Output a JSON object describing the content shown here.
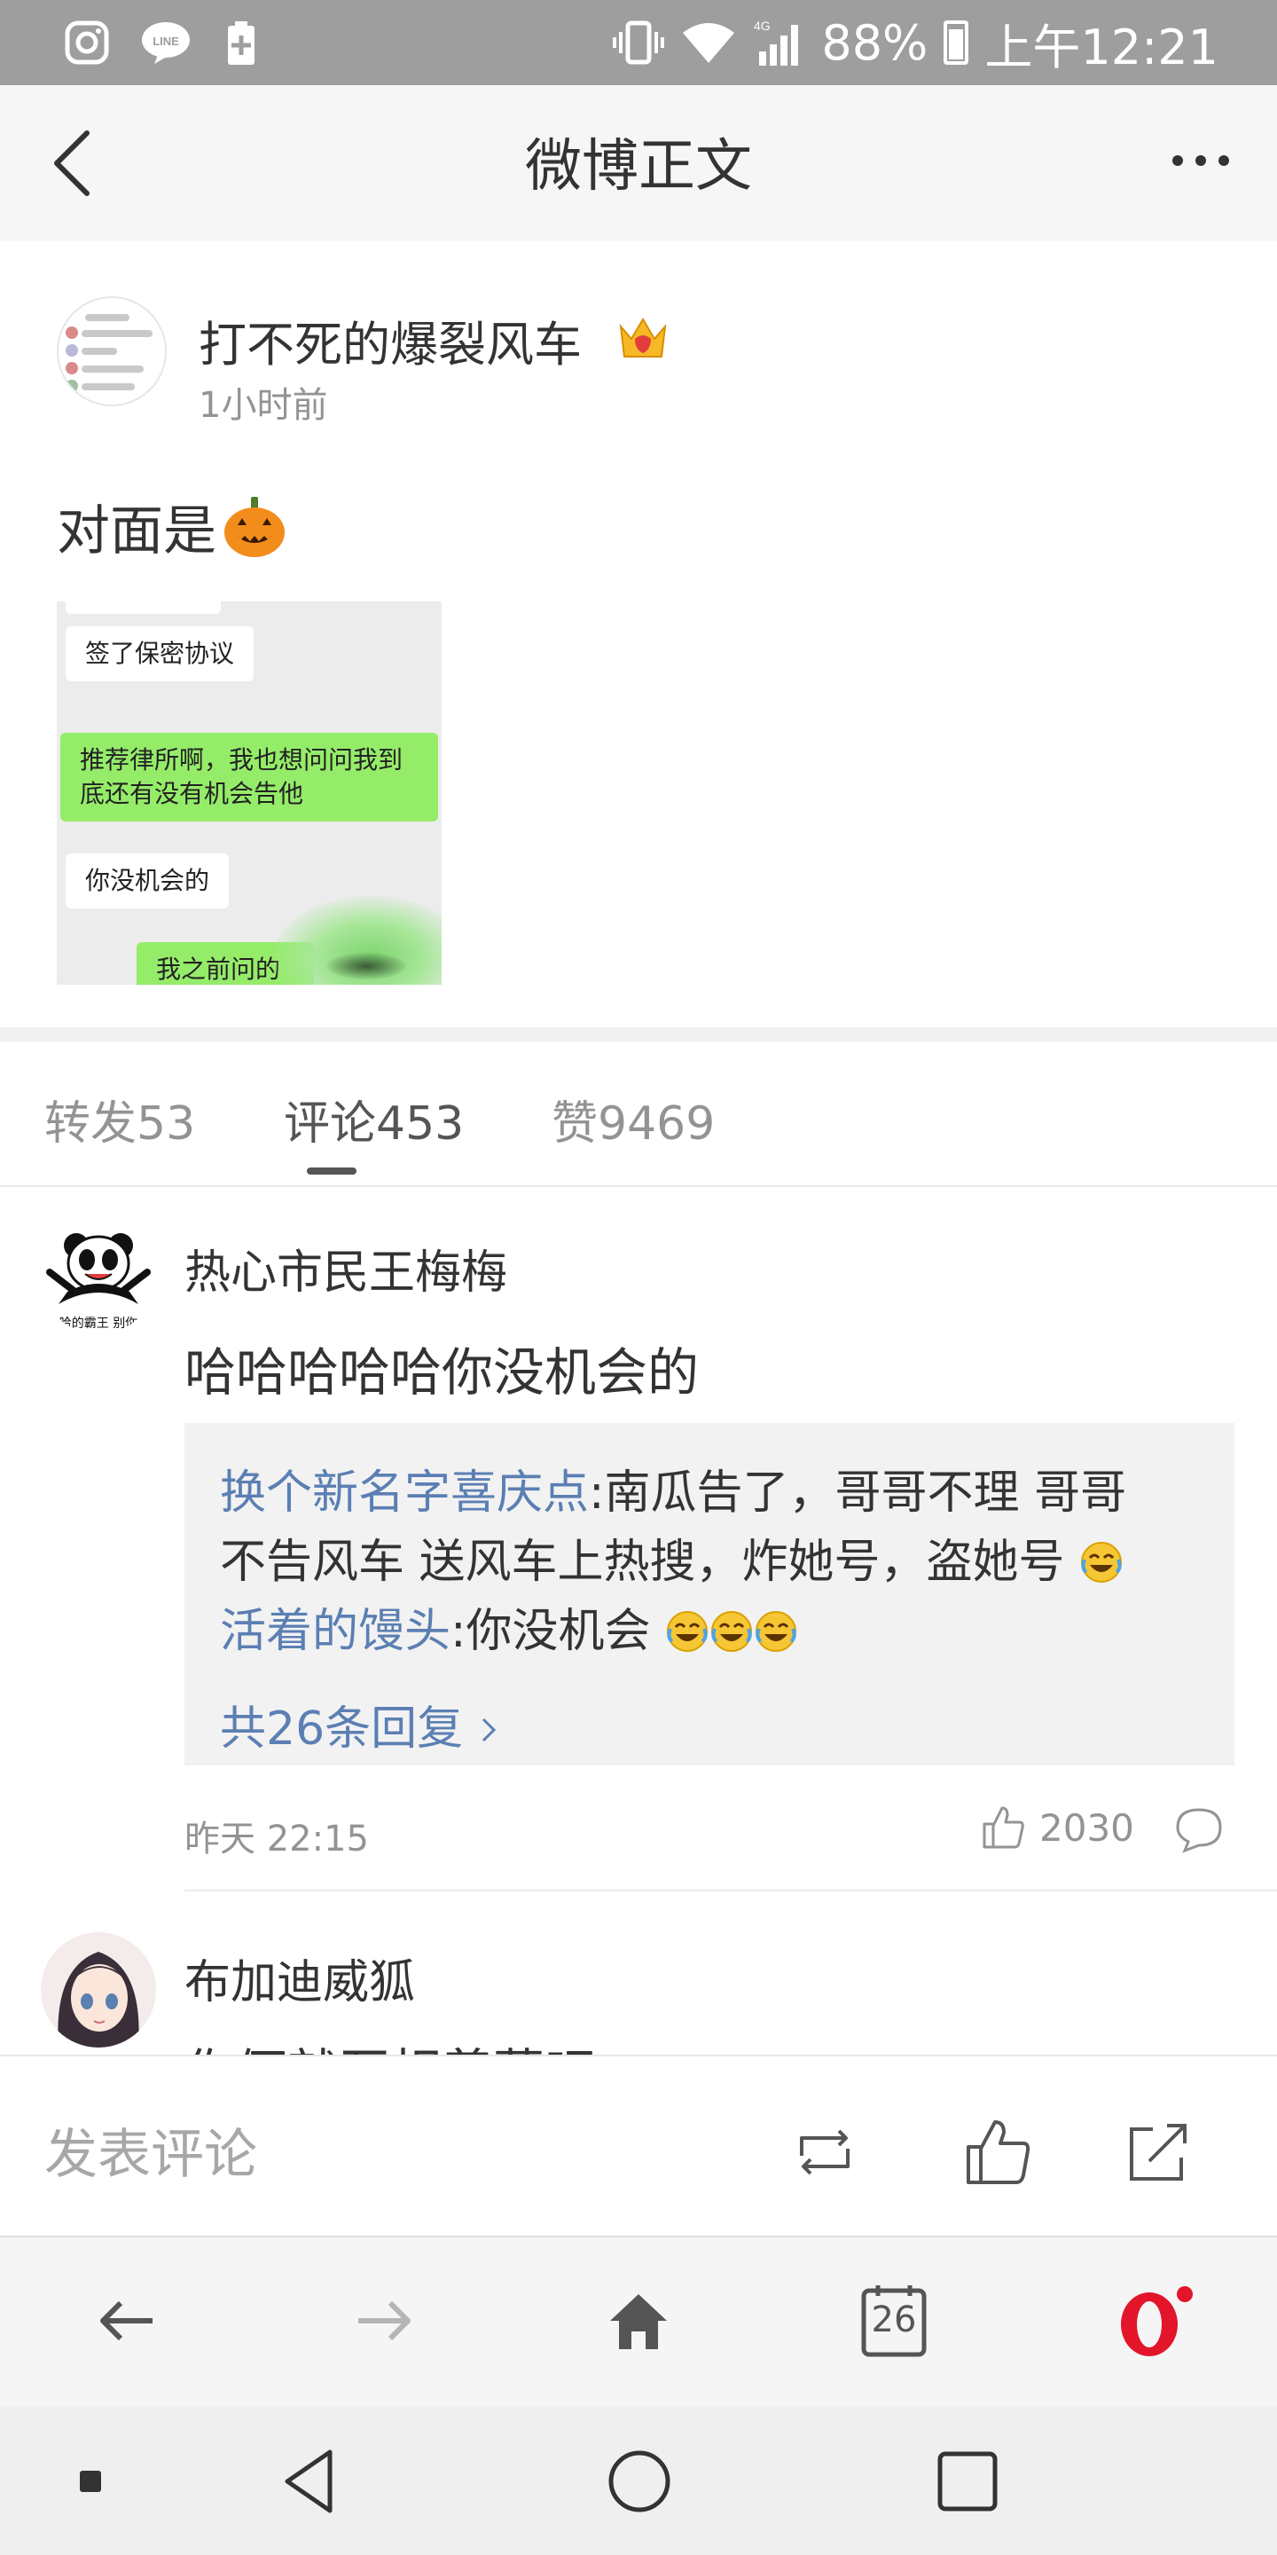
{
  "status_bar": {
    "battery": "88%",
    "time": "上午12:21",
    "network": "4G",
    "icons": [
      "instagram-icon",
      "line-icon",
      "battery-saver-icon",
      "vibrate-icon",
      "wifi-icon",
      "signal-icon",
      "battery-icon"
    ]
  },
  "nav": {
    "title": "微博正文"
  },
  "post": {
    "username": "打不死的爆裂风车",
    "time": "1小时前",
    "text": "对面是",
    "image_chat": {
      "bubbles": [
        {
          "text": "签了保密协议",
          "side": "left"
        },
        {
          "text": "推荐律所啊，我也想问问我到底还有没有机会告他",
          "side": "right"
        },
        {
          "text": "你没机会的",
          "side": "left"
        },
        {
          "text": "我之前问的",
          "side": "right"
        }
      ]
    }
  },
  "tabs": [
    {
      "label": "转发53",
      "active": false
    },
    {
      "label": "评论453",
      "active": true
    },
    {
      "label": "赞9469",
      "active": false
    }
  ],
  "comments": [
    {
      "username": "热心市民王梅梅",
      "avatar_caption": "哈的霸王 别你",
      "text": "哈哈哈哈哈你没机会的",
      "replies": [
        {
          "user": "换个新名字喜庆点",
          "text_line1": ":南瓜告了，哥哥不理 哥哥",
          "text_line2": "不告风车 送风车上热搜，炸她号，盗她号"
        },
        {
          "user": "活着的馒头",
          "text": ":你没机会"
        }
      ],
      "more_replies": "共26条回复",
      "time": "昨天 22:15",
      "likes": "2030"
    },
    {
      "username": "布加迪威狐",
      "text": "你俩就互相羡慕吧"
    }
  ],
  "comment_bar": {
    "placeholder": "发表评论"
  },
  "browser": {
    "tab_count": "26"
  },
  "colors": {
    "link_blue": "#5b7fb3",
    "chat_green": "#95ec69",
    "opera_red": "#e3152a"
  }
}
